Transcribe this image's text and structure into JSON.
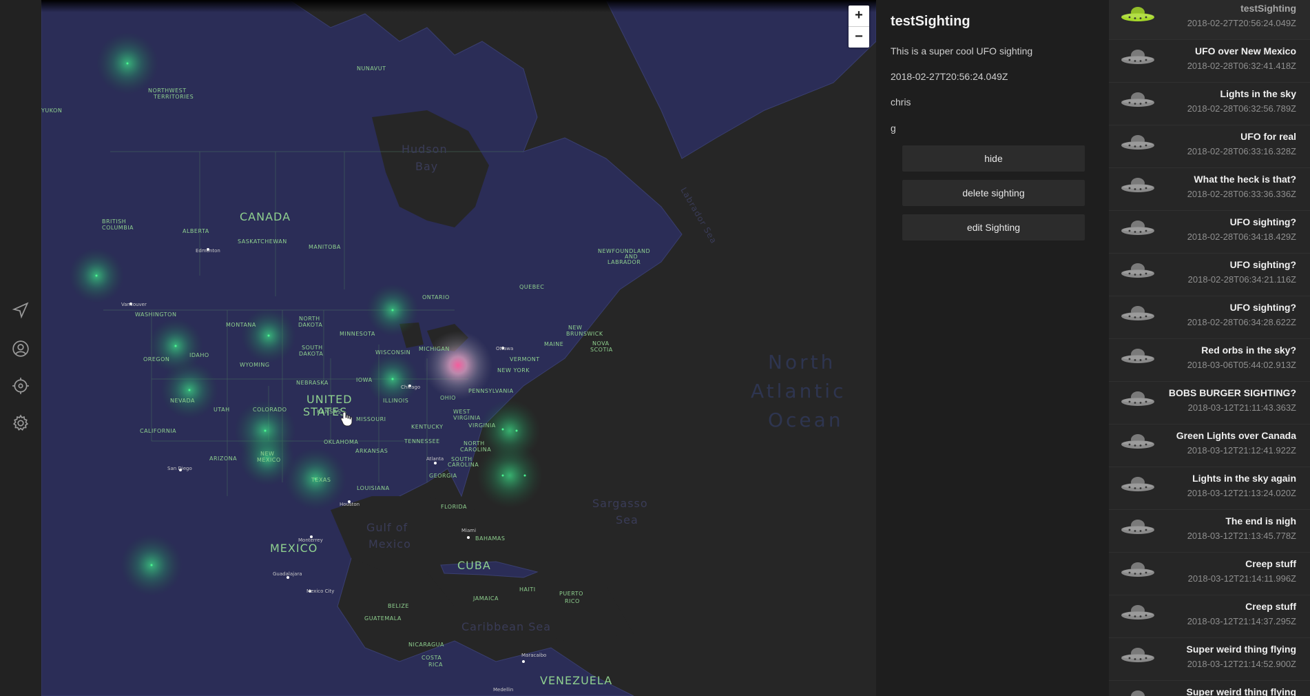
{
  "map": {
    "labels": {
      "countries": [
        "CANADA",
        "UNITED",
        "STATES",
        "MEXICO",
        "CUBA",
        "VENEZUELA"
      ],
      "water": [
        "Hudson",
        "Bay",
        "Gulf of",
        "Mexico",
        "Sargasso",
        "Sea",
        "Caribbean Sea",
        "Labrador Sea",
        "North",
        "Atlantic",
        "Ocean"
      ],
      "regions": [
        "NUNAVUT",
        "NORTHWEST",
        "TERRITORIES",
        "YUKON",
        "BRITISH",
        "COLUMBIA",
        "ALBERTA",
        "SASKATCHEWAN",
        "MANITOBA",
        "ONTARIO",
        "QUEBEC",
        "NEWFOUNDLAND",
        "AND",
        "LABRADOR",
        "NEW",
        "BRUNSWICK",
        "NOVA",
        "SCOTIA",
        "MAINE",
        "VERMONT",
        "NEW YORK",
        "PENNSYLVANIA",
        "WEST",
        "VIRGINIA",
        "VIRGINIA",
        "NORTH",
        "CAROLINA",
        "SOUTH",
        "CAROLINA",
        "GEORGIA",
        "FLORIDA",
        "WASHINGTON",
        "OREGON",
        "CALIFORNIA",
        "NEVADA",
        "IDAHO",
        "MONTANA",
        "WYOMING",
        "UTAH",
        "ARIZONA",
        "COLORADO",
        "NEW",
        "MEXICO",
        "NORTH",
        "DAKOTA",
        "SOUTH",
        "DAKOTA",
        "NEBRASKA",
        "KANSAS",
        "OKLAHOMA",
        "TEXAS",
        "MINNESOTA",
        "IOWA",
        "MISSOURI",
        "ARKANSAS",
        "LOUISIANA",
        "WISCONSIN",
        "ILLINOIS",
        "MICHIGAN",
        "OHIO",
        "KENTUCKY",
        "TENNESSEE",
        "BAHAMAS",
        "JAMAICA",
        "HAITI",
        "PUERTO",
        "RICO",
        "BELIZE",
        "GUATEMALA",
        "NICARAGUA",
        "COSTA",
        "RICA"
      ],
      "cities": [
        "Edmonton",
        "Vancouver",
        "Chicago",
        "Ottawa",
        "Atlanta",
        "Houston",
        "San Diego",
        "Monterrey",
        "Guadalajara",
        "Mexico City",
        "Miami",
        "Maracaibo",
        "Medellin"
      ]
    },
    "zoom_in": "+",
    "zoom_out": "−"
  },
  "detail": {
    "title": "testSighting",
    "description": "This is a super cool UFO sighting",
    "timestamp": "2018-02-27T20:56:24.049Z",
    "user": "chris",
    "extra": "g",
    "buttons": {
      "hide": "hide",
      "delete": "delete sighting",
      "edit": "edit Sighting"
    }
  },
  "sightings": [
    {
      "name": "testSighting",
      "time": "2018-02-27T20:56:24.049Z",
      "active": true
    },
    {
      "name": "UFO over New Mexico",
      "time": "2018-02-28T06:32:41.418Z"
    },
    {
      "name": "Lights in the sky",
      "time": "2018-02-28T06:32:56.789Z"
    },
    {
      "name": "UFO for real",
      "time": "2018-02-28T06:33:16.328Z"
    },
    {
      "name": "What the heck is that?",
      "time": "2018-02-28T06:33:36.336Z"
    },
    {
      "name": "UFO sighting?",
      "time": "2018-02-28T06:34:18.429Z"
    },
    {
      "name": "UFO sighting?",
      "time": "2018-02-28T06:34:21.116Z"
    },
    {
      "name": "UFO sighting?",
      "time": "2018-02-28T06:34:28.622Z"
    },
    {
      "name": "Red orbs in the sky?",
      "time": "2018-03-06T05:44:02.913Z"
    },
    {
      "name": "BOBS BURGER SIGHTING?",
      "time": "2018-03-12T21:11:43.363Z"
    },
    {
      "name": "Green Lights over Canada",
      "time": "2018-03-12T21:12:41.922Z"
    },
    {
      "name": "Lights in the sky again",
      "time": "2018-03-12T21:13:24.020Z"
    },
    {
      "name": "The end is nigh",
      "time": "2018-03-12T21:13:45.778Z"
    },
    {
      "name": "Creep stuff",
      "time": "2018-03-12T21:14:11.996Z"
    },
    {
      "name": "Creep stuff",
      "time": "2018-03-12T21:14:37.295Z"
    },
    {
      "name": "Super weird thing flying",
      "time": "2018-03-12T21:14:52.900Z"
    },
    {
      "name": "Super weird thing flying",
      "time": ""
    }
  ],
  "colors": {
    "land": "#2b2d57",
    "water": "#262626",
    "glow_green": "#2fd27a",
    "glow_pink": "#ff5fa0",
    "ufo_active": "#a6d82a",
    "ufo": "#8a8a8a"
  },
  "icons": [
    "navigation-icon",
    "user-icon",
    "locate-icon",
    "settings-icon",
    "ufo-icon"
  ]
}
